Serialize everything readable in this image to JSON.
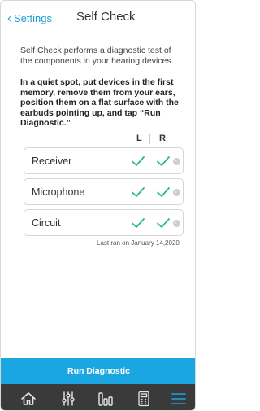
{
  "nav": {
    "back_label": "Settings",
    "title": "Self Check"
  },
  "content": {
    "intro": "Self Check performs a diagnostic test of the components in your hearing devices.",
    "instructions": "In a quiet spot, put devices in the first memory, remove them from your ears, position them on a flat surface with the earbuds pointing up, and tap “Run Diagnostic.”",
    "columns": {
      "left": "L",
      "right": "R"
    },
    "rows": [
      {
        "label": "Receiver",
        "left_status": "pass",
        "right_status": "pass"
      },
      {
        "label": "Microphone",
        "left_status": "pass",
        "right_status": "pass"
      },
      {
        "label": "Circuit",
        "left_status": "pass",
        "right_status": "pass"
      }
    ],
    "last_ran": "Last ran on January 14,2020"
  },
  "actions": {
    "run_label": "Run Diagnostic"
  },
  "tabbar": {
    "items": [
      {
        "icon": "home-icon"
      },
      {
        "icon": "sliders-icon"
      },
      {
        "icon": "bars-icon"
      },
      {
        "icon": "calculator-icon"
      },
      {
        "icon": "menu-icon",
        "active": true
      }
    ]
  },
  "colors": {
    "accent": "#19a6e1",
    "check": "#2bb59a",
    "tabbar": "#3a3a3a"
  }
}
